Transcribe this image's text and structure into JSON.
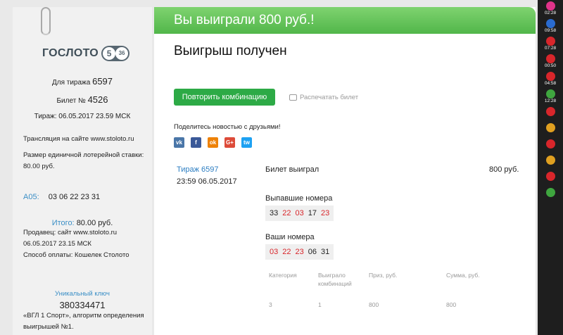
{
  "ticket": {
    "logo_text": "ГОСЛОТО",
    "logo_num1": "5",
    "logo_num2": "36",
    "draw_label": "Для тиража",
    "draw_num": "6597",
    "ticket_label": "Билет №",
    "ticket_num": "4526",
    "draw_datetime": "Тираж: 06.05.2017 23.59 МСК",
    "broadcast": "Трансляция на сайте www.stoloto.ru",
    "stake_line1": "Размер единичной лотерейной ставки:",
    "stake_line2": "80.00 руб.",
    "combo_label": "А05:",
    "combo_value": "03 06 22 23 31",
    "total_label": "Итого:",
    "total_value": "80.00 руб.",
    "seller": "Продавец: сайт www.stoloto.ru",
    "seller_date": "06.05.2017   23.15 МСК",
    "payment": "Способ оплаты: Кошелек Столото",
    "unique_key_label": "Уникальный ключ",
    "unique_key": "380334471",
    "algo_line1": "«ВГЛ 1 Спорт», алгоритм определения",
    "algo_line2": "выигрышей №1."
  },
  "main": {
    "banner_title": "Вы выиграли 800 руб.!",
    "heading": "Выигрыш получен",
    "repeat_button": "Повторить комбинацию",
    "print_link": "Распечатать билет",
    "share_text": "Поделитесь новостью с друзьями!",
    "socials": [
      "vk",
      "f",
      "ok",
      "G+",
      "tw"
    ],
    "draw_link": "Тираж 6597",
    "draw_time": "23:59 06.05.2017",
    "won_label": "Билет выиграл",
    "won_amount": "800 руб.",
    "drawn_label": "Выпавшие номера",
    "drawn_numbers": [
      {
        "n": "33",
        "hit": false
      },
      {
        "n": "22",
        "hit": true
      },
      {
        "n": "03",
        "hit": true
      },
      {
        "n": "17",
        "hit": false
      },
      {
        "n": "23",
        "hit": true
      }
    ],
    "your_label": "Ваши номера",
    "your_numbers": [
      {
        "n": "03",
        "hit": true
      },
      {
        "n": "22",
        "hit": true
      },
      {
        "n": "23",
        "hit": true
      },
      {
        "n": "06",
        "hit": false
      },
      {
        "n": "31",
        "hit": false
      }
    ],
    "table_headers": [
      "Категория",
      "Выиграло комбинаций",
      "Приз, руб.",
      "Сумма, руб."
    ],
    "table_row": [
      "3",
      "1",
      "800",
      "800"
    ]
  },
  "rail": [
    {
      "icon": "gold-lottery-icon",
      "color": "#e0338a",
      "time": "02:28"
    },
    {
      "icon": "rapido-icon",
      "color": "#2a6bd0",
      "time": "09:58"
    },
    {
      "icon": "lotto-6-45-icon",
      "color": "#d9262b",
      "time": "07:28"
    },
    {
      "icon": "top3-icon",
      "color": "#d9262b",
      "time": "00:50"
    },
    {
      "icon": "lotto-5-36-icon",
      "color": "#d9262b",
      "time": "04:58"
    },
    {
      "icon": "keno-icon",
      "color": "#3fa63f",
      "time": "12:28"
    },
    {
      "icon": "bingo-icon",
      "color": "#d9262b",
      "time": ""
    },
    {
      "icon": "sport-icon",
      "color": "#e0a020",
      "time": ""
    },
    {
      "icon": "zodiac-icon",
      "color": "#d9262b",
      "time": ""
    },
    {
      "icon": "horseshoe-icon",
      "color": "#e0a020",
      "time": ""
    },
    {
      "icon": "lotto-1-20-icon",
      "color": "#d9262b",
      "time": ""
    },
    {
      "icon": "housing-icon",
      "color": "#3fa63f",
      "time": ""
    }
  ]
}
